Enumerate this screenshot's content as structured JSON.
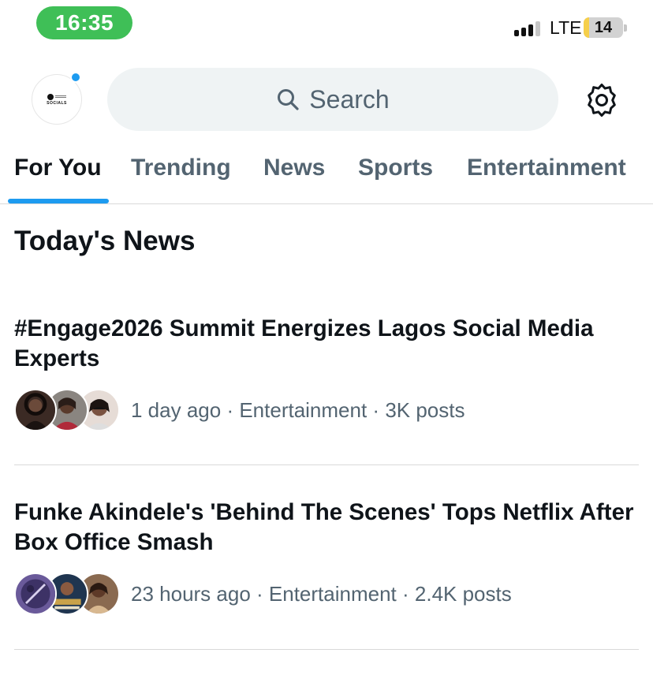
{
  "status_bar": {
    "time": "16:35",
    "network": "LTE",
    "battery": "14",
    "battery_level": 0.14,
    "accent_color": "#3fbf57"
  },
  "header": {
    "avatar_text": "SOCIALS",
    "search_placeholder": "Search",
    "search_icon": "search-icon",
    "settings_icon": "gear-icon",
    "notification_color": "#1d9bf0"
  },
  "tabs": [
    {
      "label": "For You",
      "active": true
    },
    {
      "label": "Trending",
      "active": false
    },
    {
      "label": "News",
      "active": false
    },
    {
      "label": "Sports",
      "active": false
    },
    {
      "label": "Entertainment",
      "active": false
    }
  ],
  "section_title": "Today's News",
  "news": [
    {
      "title": "#Engage2026 Summit Energizes Lagos Social Media Experts",
      "time": "1 day ago",
      "category": "Entertainment",
      "posts": "3K posts"
    },
    {
      "title": "Funke Akindele's 'Behind The Scenes' Tops Netflix After Box Office Smash",
      "time": "23 hours ago",
      "category": "Entertainment",
      "posts": "2.4K posts"
    }
  ],
  "separator": " · ",
  "colors": {
    "accent": "#1d9bf0",
    "text_primary": "#0f1419",
    "text_secondary": "#536471",
    "search_bg": "#eff3f4"
  }
}
